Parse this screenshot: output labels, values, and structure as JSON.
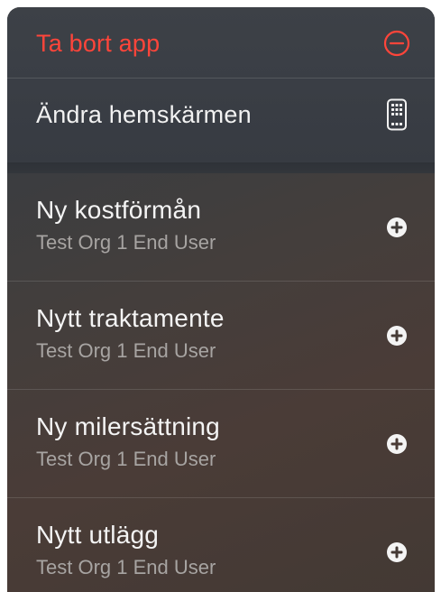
{
  "system_actions": [
    {
      "label": "Ta bort app",
      "icon": "minus-circle-icon",
      "color": "#ff453a"
    },
    {
      "label": "Ändra hemskärmen",
      "icon": "phone-screen-icon"
    }
  ],
  "shortcuts": [
    {
      "title": "Ny kostförmån",
      "subtitle": "Test Org 1 End User",
      "icon": "plus-circle-icon"
    },
    {
      "title": "Nytt traktamente",
      "subtitle": "Test Org 1 End User",
      "icon": "plus-circle-icon"
    },
    {
      "title": "Ny milersättning",
      "subtitle": "Test Org 1 End User",
      "icon": "plus-circle-icon"
    },
    {
      "title": "Nytt utlägg",
      "subtitle": "Test Org 1 End User",
      "icon": "plus-circle-icon"
    }
  ]
}
